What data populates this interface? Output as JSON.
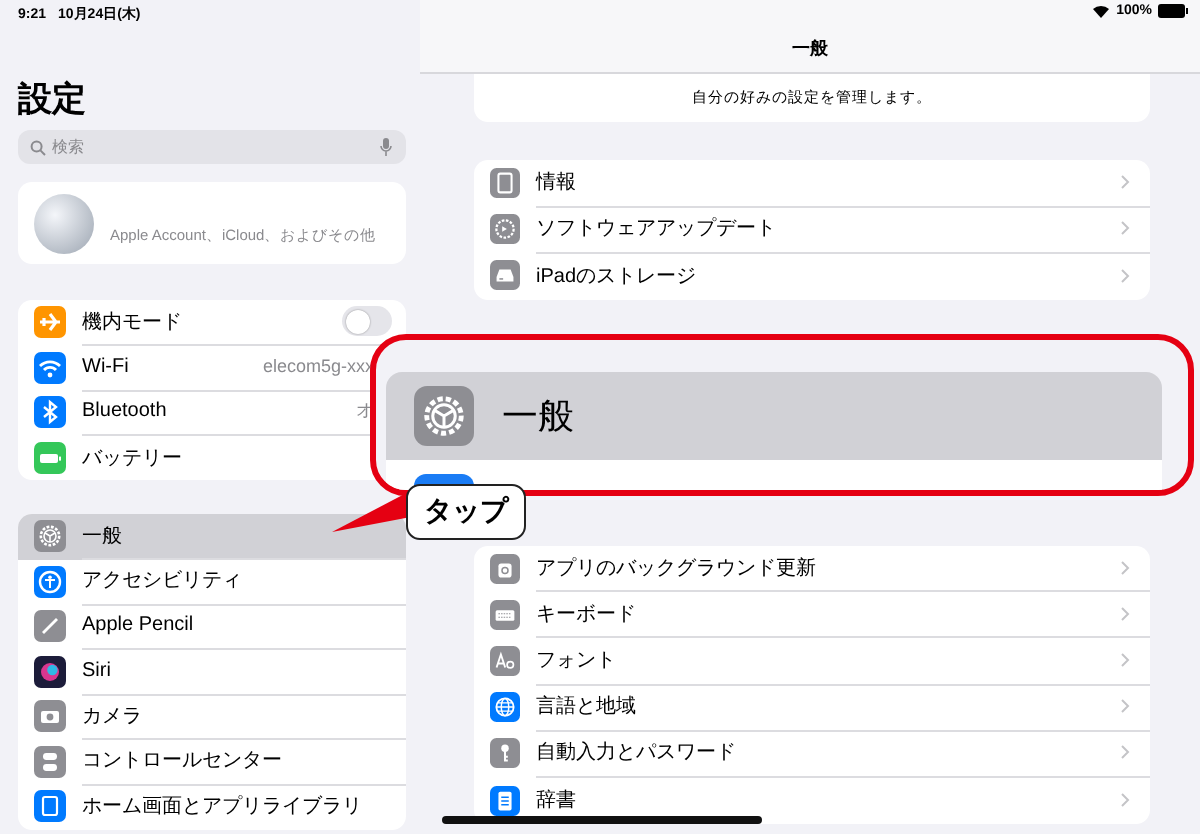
{
  "status_bar": {
    "time": "9:21",
    "date": "10月24日(木)",
    "battery": "100%"
  },
  "sidebar": {
    "title": "設定",
    "search": {
      "placeholder": "検索"
    },
    "account": {
      "subtitle": "Apple Account、iCloud、およびその他"
    },
    "groups": [
      {
        "items": [
          {
            "label": "機内モード",
            "kind": "toggle",
            "on": false,
            "selected": false
          },
          {
            "label": "Wi-Fi",
            "kind": "value",
            "value": "elecom5g-xxx",
            "selected": false
          },
          {
            "label": "Bluetooth",
            "kind": "value",
            "value": "オ",
            "selected": false
          },
          {
            "label": "バッテリー",
            "kind": "plain",
            "selected": false
          }
        ]
      },
      {
        "items": [
          {
            "label": "一般",
            "kind": "plain",
            "selected": true
          },
          {
            "label": "アクセシビリティ",
            "kind": "plain",
            "selected": false
          },
          {
            "label": "Apple Pencil",
            "kind": "plain",
            "selected": false
          },
          {
            "label": "Siri",
            "kind": "plain",
            "selected": false
          },
          {
            "label": "カメラ",
            "kind": "plain",
            "selected": false
          },
          {
            "label": "コントロールセンター",
            "kind": "plain",
            "selected": false
          },
          {
            "label": "ホーム画面とアプリライブラリ",
            "kind": "plain",
            "selected": false
          }
        ]
      }
    ]
  },
  "detail": {
    "title": "一般",
    "intro": "自分の好みの設定を管理します。",
    "groups": [
      {
        "items": [
          {
            "label": "情報"
          },
          {
            "label": "ソフトウェアアップデート"
          },
          {
            "label": "iPadのストレージ"
          }
        ]
      },
      {
        "items": [
          {
            "label": "アプリのバックグラウンド更新"
          },
          {
            "label": "キーボード"
          },
          {
            "label": "フォント"
          },
          {
            "label": "言語と地域"
          },
          {
            "label": "自動入力とパスワード"
          },
          {
            "label": "辞書"
          }
        ]
      }
    ]
  },
  "callout": {
    "title": "一般",
    "label": "タップ"
  }
}
